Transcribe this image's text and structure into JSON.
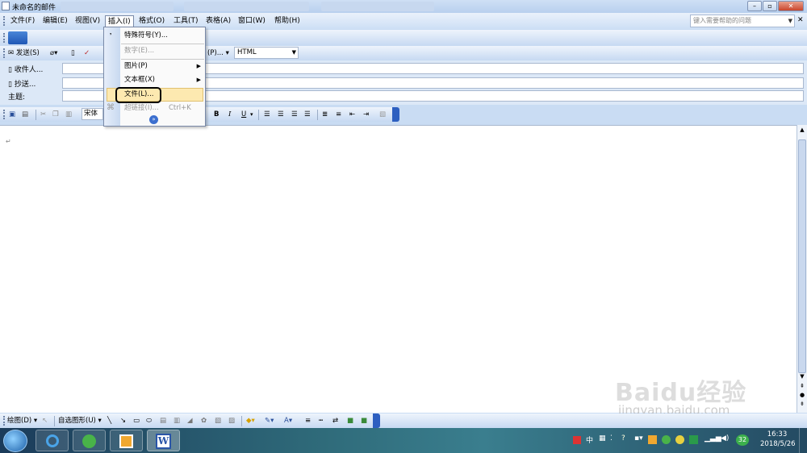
{
  "window": {
    "title": "未命名的邮件",
    "ghost_tabs": [
      "",
      "",
      ""
    ]
  },
  "menubar": {
    "items": [
      "文件(F)",
      "编辑(E)",
      "视图(V)",
      "插入(I)",
      "格式(O)",
      "工具(T)",
      "表格(A)",
      "窗口(W)",
      "帮助(H)"
    ],
    "help_placeholder": "键入需要帮助的问题"
  },
  "send_toolbar": {
    "send_label": "发送(S)",
    "options_label": "(P)...",
    "format_value": "HTML"
  },
  "address": {
    "to_label": "收件人...",
    "cc_label": "抄送...",
    "subject_label": "主题:"
  },
  "format_toolbar": {
    "font": "宋体",
    "bold": "B",
    "italic": "I",
    "underline": "U"
  },
  "insert_menu": {
    "items": [
      {
        "label": "特殊符号(Y)...",
        "disabled": false,
        "submenu": false
      },
      {
        "label": "数字(E)...",
        "disabled": true,
        "submenu": false
      },
      {
        "label": "图片(P)",
        "disabled": false,
        "submenu": true
      },
      {
        "label": "文本框(X)",
        "disabled": false,
        "submenu": true
      },
      {
        "label": "文件(L)...",
        "disabled": false,
        "submenu": false,
        "highlighted": true
      },
      {
        "label": "超链接(I)...",
        "disabled": true,
        "submenu": false,
        "shortcut": "Ctrl+K"
      }
    ],
    "expand_icon": "double-chevron-down-icon"
  },
  "document": {
    "paragraph_mark": "↵"
  },
  "draw_toolbar": {
    "draw_label": "绘图(D)",
    "autoshape_label": "自选图形(U)"
  },
  "taskbar": {
    "clock_time": "16:33",
    "clock_date": "2018/5/26",
    "ime": "中",
    "badge": "32"
  },
  "watermark": {
    "brand": "Baidu经验",
    "url": "jingyan.baidu.com"
  }
}
